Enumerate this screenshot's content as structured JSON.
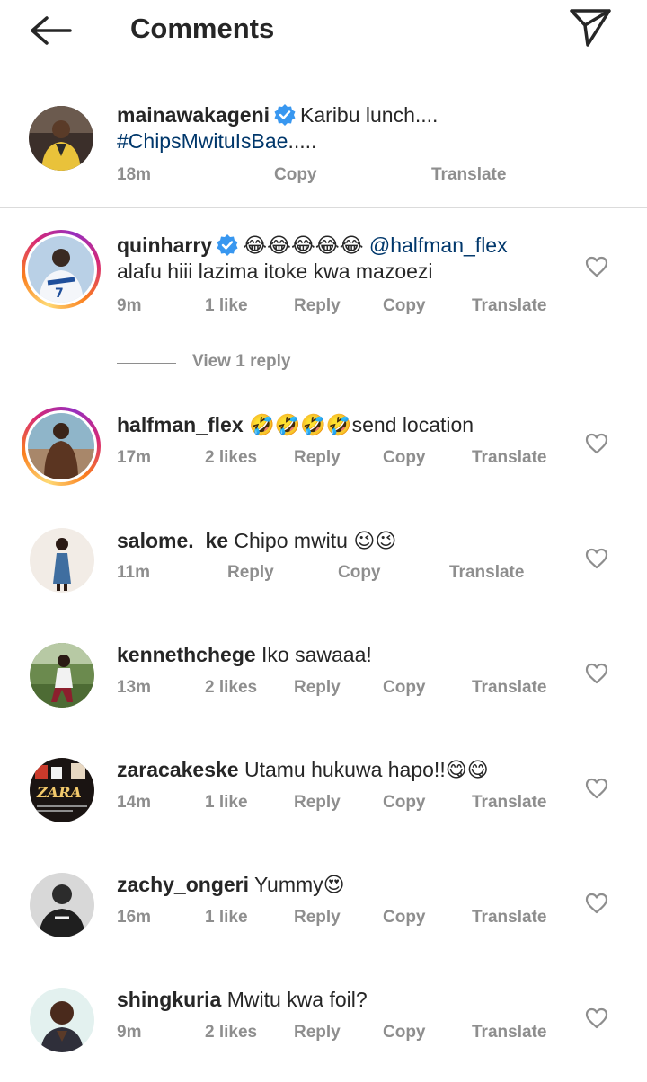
{
  "header": {
    "title": "Comments",
    "back_icon": "arrow-left-icon",
    "send_icon": "paper-plane-icon"
  },
  "caption": {
    "username": "mainawakageni",
    "verified": true,
    "text": "Karibu lunch....",
    "hashtag": "#ChipsMwituIsBae",
    "hashtag_suffix": ".....",
    "time": "18m",
    "copy": "Copy",
    "translate": "Translate"
  },
  "comments": [
    {
      "username": "quinharry",
      "verified": true,
      "emojis": "😂😂😂😂😂",
      "mention": "@halfman_flex",
      "text_line2": "alafu hiii lazima itoke kwa mazoezi",
      "time": "9m",
      "likes": "1 like",
      "reply": "Reply",
      "copy": "Copy",
      "translate": "Translate"
    },
    {
      "username": "halfman_flex",
      "emojis": "🤣🤣🤣🤣",
      "text": "send location",
      "time": "17m",
      "likes": "2 likes",
      "reply": "Reply",
      "copy": "Copy",
      "translate": "Translate"
    },
    {
      "username": "salome._ke",
      "text": "Chipo mwitu",
      "emojis": "😉😉",
      "time": "11m",
      "reply": "Reply",
      "copy": "Copy",
      "translate": "Translate"
    },
    {
      "username": "kennethchege",
      "text": "Iko sawaaa!",
      "time": "13m",
      "likes": "2 likes",
      "reply": "Reply",
      "copy": "Copy",
      "translate": "Translate"
    },
    {
      "username": "zaracakeske",
      "text": "Utamu hukuwa hapo!!",
      "emojis": "😋😋",
      "time": "14m",
      "likes": "1 like",
      "reply": "Reply",
      "copy": "Copy",
      "translate": "Translate"
    },
    {
      "username": "zachy_ongeri",
      "text": "Yummy",
      "emojis": "😍",
      "time": "16m",
      "likes": "1 like",
      "reply": "Reply",
      "copy": "Copy",
      "translate": "Translate"
    },
    {
      "username": "shingkuria",
      "text": "Mwitu kwa foil?",
      "time": "9m",
      "likes": "2 likes",
      "reply": "Reply",
      "copy": "Copy",
      "translate": "Translate"
    }
  ],
  "view_replies": "View 1 reply",
  "colors": {
    "text": "#262626",
    "meta": "#8e8e8e",
    "link": "#00376b",
    "verified": "#3897f0",
    "divider": "#dbdbdb"
  }
}
